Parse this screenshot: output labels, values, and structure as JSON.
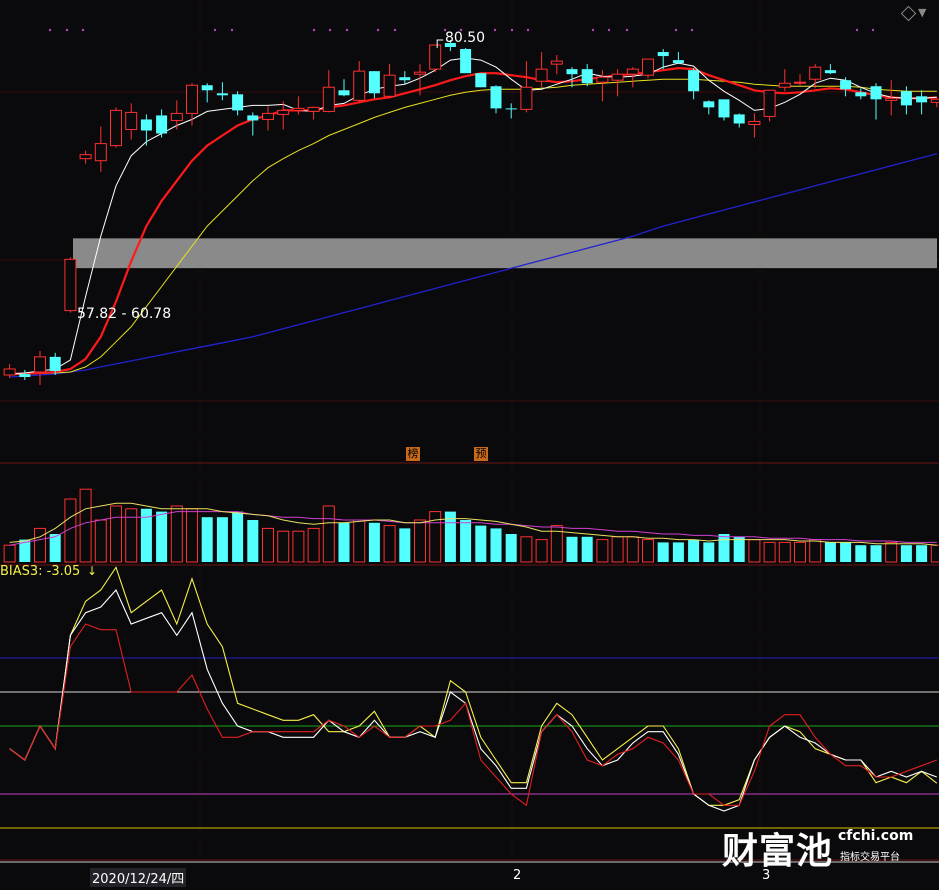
{
  "chart_data": [
    {
      "type": "candlestick",
      "annotations": {
        "price_high": "80.50",
        "zone": "57.82 - 60.78",
        "tags": [
          "榜",
          "预"
        ]
      },
      "candles": [
        {
          "o": 47.2,
          "c": 47.8,
          "h": 48.3,
          "l": 46.9,
          "dir": "up"
        },
        {
          "o": 47.3,
          "c": 47.0,
          "h": 47.7,
          "l": 46.7,
          "dir": "down"
        },
        {
          "o": 47.5,
          "c": 49.0,
          "h": 49.6,
          "l": 46.2,
          "dir": "up"
        },
        {
          "o": 49.0,
          "c": 47.6,
          "h": 49.4,
          "l": 47.2,
          "dir": "down"
        },
        {
          "o": 53.6,
          "c": 58.7,
          "h": 58.9,
          "l": 53.4,
          "dir": "up"
        },
        {
          "o": 68.7,
          "c": 69.1,
          "h": 69.5,
          "l": 68.2,
          "dir": "up"
        },
        {
          "o": 68.5,
          "c": 70.2,
          "h": 71.9,
          "l": 67.4,
          "dir": "up"
        },
        {
          "o": 70.0,
          "c": 73.5,
          "h": 73.8,
          "l": 69.8,
          "dir": "up"
        },
        {
          "o": 71.6,
          "c": 73.3,
          "h": 74.2,
          "l": 70.6,
          "dir": "up"
        },
        {
          "o": 72.6,
          "c": 71.5,
          "h": 73.1,
          "l": 70.0,
          "dir": "down"
        },
        {
          "o": 73.0,
          "c": 71.2,
          "h": 73.6,
          "l": 70.8,
          "dir": "down"
        },
        {
          "o": 72.5,
          "c": 73.2,
          "h": 74.5,
          "l": 71.6,
          "dir": "up"
        },
        {
          "o": 73.2,
          "c": 76.0,
          "h": 76.2,
          "l": 72.0,
          "dir": "up"
        },
        {
          "o": 76.0,
          "c": 75.5,
          "h": 76.2,
          "l": 74.3,
          "dir": "down"
        },
        {
          "o": 75.2,
          "c": 75.0,
          "h": 76.3,
          "l": 74.5,
          "dir": "down"
        },
        {
          "o": 75.1,
          "c": 73.5,
          "h": 75.4,
          "l": 73.0,
          "dir": "down"
        },
        {
          "o": 73.0,
          "c": 72.5,
          "h": 73.3,
          "l": 71.0,
          "dir": "down"
        },
        {
          "o": 72.6,
          "c": 73.2,
          "h": 73.9,
          "l": 71.5,
          "dir": "up"
        },
        {
          "o": 73.1,
          "c": 73.5,
          "h": 74.4,
          "l": 71.6,
          "dir": "up"
        },
        {
          "o": 73.5,
          "c": 73.7,
          "h": 74.9,
          "l": 73.1,
          "dir": "up"
        },
        {
          "o": 73.4,
          "c": 73.8,
          "h": 73.9,
          "l": 72.6,
          "dir": "up"
        },
        {
          "o": 73.4,
          "c": 75.8,
          "h": 77.5,
          "l": 73.3,
          "dir": "up"
        },
        {
          "o": 75.5,
          "c": 75.0,
          "h": 76.6,
          "l": 74.9,
          "dir": "down"
        },
        {
          "o": 74.5,
          "c": 77.4,
          "h": 78.4,
          "l": 74.2,
          "dir": "up"
        },
        {
          "o": 77.4,
          "c": 75.2,
          "h": 77.4,
          "l": 74.7,
          "dir": "down"
        },
        {
          "o": 74.9,
          "c": 77.0,
          "h": 78.1,
          "l": 74.7,
          "dir": "up"
        },
        {
          "o": 76.8,
          "c": 76.5,
          "h": 77.4,
          "l": 76.1,
          "dir": "down"
        },
        {
          "o": 77.1,
          "c": 77.3,
          "h": 78.1,
          "l": 75.0,
          "dir": "up"
        },
        {
          "o": 77.6,
          "c": 80.0,
          "h": 80.0,
          "l": 77.3,
          "dir": "up"
        },
        {
          "o": 79.8,
          "c": 80.2,
          "h": 80.5,
          "l": 79.4,
          "dir": "down"
        },
        {
          "o": 79.6,
          "c": 77.2,
          "h": 79.7,
          "l": 77.2,
          "dir": "down"
        },
        {
          "o": 77.2,
          "c": 75.8,
          "h": 77.2,
          "l": 75.8,
          "dir": "down"
        },
        {
          "o": 75.9,
          "c": 73.7,
          "h": 76.0,
          "l": 73.2,
          "dir": "down"
        },
        {
          "o": 73.7,
          "c": 73.6,
          "h": 74.2,
          "l": 72.7,
          "dir": "down"
        },
        {
          "o": 73.6,
          "c": 75.8,
          "h": 78.4,
          "l": 73.3,
          "dir": "up"
        },
        {
          "o": 76.4,
          "c": 77.6,
          "h": 79.3,
          "l": 75.8,
          "dir": "up"
        },
        {
          "o": 78.1,
          "c": 78.4,
          "h": 79.0,
          "l": 77.1,
          "dir": "up"
        },
        {
          "o": 77.6,
          "c": 77.1,
          "h": 77.8,
          "l": 75.8,
          "dir": "down"
        },
        {
          "o": 77.6,
          "c": 76.2,
          "h": 78.1,
          "l": 75.9,
          "dir": "down"
        },
        {
          "o": 76.3,
          "c": 76.8,
          "h": 77.5,
          "l": 74.4,
          "dir": "up"
        },
        {
          "o": 76.5,
          "c": 77.1,
          "h": 77.6,
          "l": 74.9,
          "dir": "up"
        },
        {
          "o": 77.1,
          "c": 77.6,
          "h": 77.8,
          "l": 75.8,
          "dir": "up"
        },
        {
          "o": 77.0,
          "c": 78.6,
          "h": 78.6,
          "l": 76.7,
          "dir": "up"
        },
        {
          "o": 79.3,
          "c": 78.9,
          "h": 79.6,
          "l": 77.6,
          "dir": "down"
        },
        {
          "o": 78.5,
          "c": 78.2,
          "h": 79.3,
          "l": 78.1,
          "dir": "down"
        },
        {
          "o": 77.5,
          "c": 75.4,
          "h": 77.7,
          "l": 74.6,
          "dir": "down"
        },
        {
          "o": 74.4,
          "c": 73.8,
          "h": 74.5,
          "l": 73.1,
          "dir": "down"
        },
        {
          "o": 74.6,
          "c": 72.8,
          "h": 74.6,
          "l": 72.5,
          "dir": "down"
        },
        {
          "o": 73.1,
          "c": 72.2,
          "h": 73.2,
          "l": 71.8,
          "dir": "down"
        },
        {
          "o": 72.1,
          "c": 72.4,
          "h": 73.2,
          "l": 70.8,
          "dir": "up"
        },
        {
          "o": 72.9,
          "c": 75.5,
          "h": 75.5,
          "l": 72.4,
          "dir": "up"
        },
        {
          "o": 75.8,
          "c": 76.2,
          "h": 77.6,
          "l": 75.4,
          "dir": "up"
        },
        {
          "o": 76.2,
          "c": 76.3,
          "h": 77.1,
          "l": 76.0,
          "dir": "up"
        },
        {
          "o": 76.6,
          "c": 77.8,
          "h": 78.1,
          "l": 75.7,
          "dir": "up"
        },
        {
          "o": 77.5,
          "c": 77.2,
          "h": 78.1,
          "l": 77.1,
          "dir": "down"
        },
        {
          "o": 76.5,
          "c": 75.6,
          "h": 76.8,
          "l": 74.9,
          "dir": "down"
        },
        {
          "o": 75.3,
          "c": 74.9,
          "h": 75.7,
          "l": 74.6,
          "dir": "down"
        },
        {
          "o": 75.9,
          "c": 74.6,
          "h": 76.2,
          "l": 72.6,
          "dir": "down"
        },
        {
          "o": 74.5,
          "c": 74.7,
          "h": 76.5,
          "l": 73.0,
          "dir": "up"
        },
        {
          "o": 75.4,
          "c": 74.0,
          "h": 75.9,
          "l": 73.1,
          "dir": "down"
        },
        {
          "o": 74.9,
          "c": 74.3,
          "h": 75.5,
          "l": 73.1,
          "dir": "down"
        },
        {
          "o": 74.3,
          "c": 74.6,
          "h": 74.8,
          "l": 73.8,
          "dir": "up"
        }
      ],
      "ma5": [
        47.3,
        47.4,
        47.6,
        47.8,
        48.7,
        55,
        61,
        66,
        69,
        70.4,
        71.2,
        72,
        72.6,
        73.4,
        73.6,
        73.8,
        74,
        74,
        74.1,
        73.5,
        73.4,
        74,
        74.2,
        75,
        75.6,
        75.9,
        76.1,
        76.7,
        77.5,
        78.5,
        78.7,
        78.5,
        77.8,
        76.6,
        75.5,
        75.6,
        76.1,
        76.6,
        77.2,
        76.9,
        76.8,
        76.9,
        77.1,
        77.8,
        78.2,
        77.9,
        76.5,
        75.4,
        74.5,
        73.5,
        73.7,
        74.3,
        75.1,
        76.2,
        76.7,
        76.5,
        75.8,
        75.2,
        74.8,
        74.7,
        74.7,
        74.8
      ],
      "ma10": [
        47.3,
        47.35,
        47.4,
        47.5,
        47.8,
        48.8,
        51,
        54.5,
        58.5,
        62,
        64.5,
        66.5,
        68.5,
        70,
        71,
        72,
        72.6,
        73,
        73.5,
        73.5,
        73.5,
        73.8,
        74,
        74.3,
        74.6,
        74.8,
        75.2,
        75.6,
        76,
        76.5,
        76.9,
        77.2,
        77.2,
        77,
        76.8,
        76.5,
        76.3,
        76.4,
        76.6,
        76.8,
        77,
        77.1,
        77.3,
        77.5,
        77.7,
        77.6,
        77,
        76.5,
        76,
        75.5,
        75.3,
        75.2,
        75.3,
        75.5,
        75.7,
        75.6,
        75.3,
        75,
        74.8,
        74.7,
        74.7,
        74.8
      ],
      "ma20": [
        47.2,
        47.3,
        47.35,
        47.4,
        47.5,
        48,
        49,
        50.5,
        52,
        54,
        56,
        58,
        60,
        62,
        63.5,
        65,
        66.5,
        67.8,
        68.7,
        69.5,
        70.2,
        71,
        71.6,
        72.2,
        72.8,
        73.3,
        73.8,
        74.2,
        74.6,
        75,
        75.3,
        75.5,
        75.6,
        75.6,
        75.6,
        75.7,
        75.8,
        76,
        76.1,
        76.2,
        76.3,
        76.4,
        76.5,
        76.6,
        76.6,
        76.6,
        76.5,
        76.4,
        76.3,
        76.1,
        76,
        75.9,
        75.9,
        75.9,
        75.9,
        75.9,
        75.8,
        75.6,
        75.5,
        75.4,
        75.4,
        75.4
      ],
      "ma60": [
        47,
        47.1,
        47.2,
        47.3,
        47.5,
        47.7,
        48,
        48.3,
        48.6,
        48.9,
        49.2,
        49.5,
        49.8,
        50.1,
        50.4,
        50.7,
        51,
        51.4,
        51.8,
        52.2,
        52.6,
        53,
        53.4,
        53.8,
        54.2,
        54.6,
        55,
        55.4,
        55.8,
        56.2,
        56.6,
        57,
        57.4,
        57.8,
        58.2,
        58.6,
        59,
        59.4,
        59.8,
        60.2,
        60.6,
        61,
        61.5,
        62,
        62.4,
        62.8,
        63.2,
        63.6,
        64,
        64.4,
        64.8,
        65.2,
        65.6,
        66,
        66.4,
        66.8,
        67.2,
        67.6,
        68,
        68.4,
        68.8,
        69.2
      ]
    },
    {
      "type": "bar",
      "colors": {
        "up": "#ff3030",
        "down": "#54ffff"
      },
      "values": [
        12,
        16,
        24,
        20,
        45,
        52,
        30,
        40,
        38,
        38,
        36,
        40,
        38,
        32,
        32,
        36,
        30,
        24,
        22,
        22,
        24,
        40,
        28,
        30,
        28,
        26,
        24,
        30,
        36,
        36,
        30,
        26,
        24,
        20,
        18,
        16,
        26,
        18,
        18,
        16,
        18,
        18,
        16,
        14,
        14,
        16,
        14,
        20,
        18,
        16,
        14,
        14,
        14,
        16,
        14,
        14,
        12,
        12,
        14,
        12,
        12,
        12
      ],
      "ma_white": [
        14,
        15,
        18,
        24,
        32,
        38,
        40,
        42,
        42,
        40,
        38,
        38,
        38,
        38,
        36,
        35,
        34,
        33,
        30,
        28,
        27,
        28,
        28,
        29,
        30,
        30,
        28,
        28,
        30,
        31,
        31,
        30,
        29,
        27,
        25,
        22,
        22,
        21,
        20,
        19,
        18,
        18,
        17,
        17,
        16,
        16,
        15,
        16,
        16,
        16,
        16,
        16,
        15,
        15,
        14,
        14,
        14,
        13,
        13,
        13,
        13,
        12
      ],
      "ma_magenta": [
        12,
        14,
        16,
        18,
        24,
        28,
        30,
        32,
        32,
        32,
        34,
        36,
        36,
        36,
        36,
        36,
        34,
        33,
        32,
        32,
        31,
        31,
        30,
        30,
        30,
        29,
        28,
        28,
        28,
        28,
        28,
        28,
        27,
        27,
        26,
        25,
        25,
        24,
        24,
        23,
        22,
        22,
        21,
        20,
        20,
        19,
        19,
        18,
        18,
        18,
        17,
        17,
        17,
        16,
        16,
        16,
        15,
        15,
        15,
        14,
        14,
        14
      ]
    },
    {
      "type": "line",
      "title": "BIAS3: -3.05",
      "levels": [
        8,
        5,
        2,
        -4,
        -7
      ],
      "level_colors": [
        "#2020c8",
        "#d8d8d8",
        "#18a818",
        "#c040c0",
        "#d8c000"
      ],
      "ylim": [
        -10,
        20
      ],
      "series": [
        {
          "color": "#f5f04a",
          "values": [
            0,
            -1,
            2,
            0,
            10,
            13,
            14,
            16,
            12,
            13,
            14,
            11,
            15,
            11,
            9,
            4,
            3.5,
            3,
            2.5,
            2.5,
            3,
            1.5,
            1.5,
            2,
            3.3,
            1,
            1,
            2,
            1,
            6,
            5,
            1,
            -1,
            -3,
            -3,
            2,
            4,
            3,
            1,
            -1,
            0,
            1,
            2,
            2,
            0,
            -4,
            -5,
            -5,
            -4.5,
            -1,
            1,
            2,
            1.5,
            0,
            -0.5,
            -1,
            -1,
            -3,
            -2.5,
            -3,
            -2,
            -3.05
          ]
        },
        {
          "color": "#ffffff",
          "values": [
            0,
            -1,
            2,
            0,
            10,
            12,
            12.5,
            14,
            11,
            11.5,
            12,
            10,
            12,
            7,
            4,
            2,
            1.5,
            1.5,
            1,
            1,
            1,
            2.5,
            1.5,
            1,
            2.5,
            1,
            1,
            1.5,
            1,
            5,
            4,
            0,
            -1.5,
            -3.5,
            -3.5,
            1.5,
            3,
            2,
            0,
            -1.5,
            -1,
            0.5,
            1.5,
            1.5,
            -0.5,
            -4,
            -5,
            -5.5,
            -5,
            -1,
            1,
            2,
            1,
            0.5,
            -0.5,
            -1,
            -1,
            -2.5,
            -2,
            -2.5,
            -2,
            -2.5
          ]
        },
        {
          "color": "#e02020",
          "values": [
            0,
            -1,
            2,
            0,
            9,
            11,
            10.5,
            10.5,
            5,
            5,
            5,
            5,
            6.5,
            3.5,
            1,
            1,
            1.5,
            1.5,
            1.5,
            1.5,
            1.5,
            2.5,
            2,
            1,
            2,
            1,
            1,
            2,
            2,
            2.5,
            4,
            -1,
            -2.5,
            -4,
            -5,
            1.5,
            3,
            1.5,
            -1,
            -1.5,
            -0.5,
            0,
            1,
            0.5,
            -1,
            -4,
            -4,
            -5,
            -5,
            -2,
            2,
            3,
            3,
            1,
            -0.5,
            -1.5,
            -1.5,
            -2.5,
            -2.5,
            -2,
            -1.5,
            -1
          ]
        }
      ]
    }
  ],
  "labels": {
    "price_high": "80.50",
    "zone": "57.82 - 60.78",
    "tag1": "榜",
    "tag2": "预",
    "bias": "BIAS3: -3.05",
    "bias_arrow": "↓",
    "date": "2020/12/24/四",
    "xtick_2": "2",
    "xtick_3": "3",
    "wm_main": "财富池",
    "wm_domain": "cfchi.com",
    "wm_sub": "指标交易平台"
  },
  "icons": {
    "diamond": "diamond-icon",
    "down": "chevron-down-icon"
  }
}
